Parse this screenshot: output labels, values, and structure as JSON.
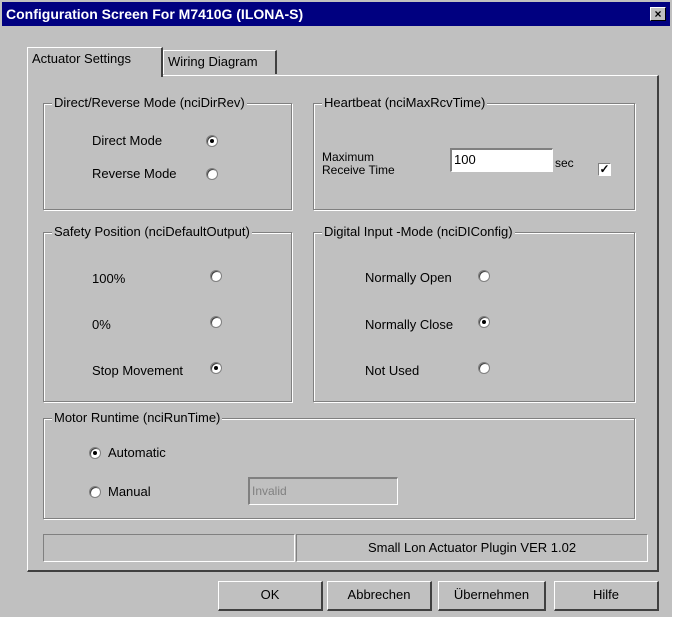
{
  "window": {
    "title": "Configuration Screen For M7410G (ILONA-S)",
    "close_label": "×"
  },
  "tabs": [
    {
      "label": "Actuator Settings",
      "active": true
    },
    {
      "label": "Wiring Diagram",
      "active": false
    }
  ],
  "direct_reverse": {
    "legend": "Direct/Reverse Mode (nciDirRev)",
    "options": [
      {
        "label": "Direct Mode",
        "selected": true
      },
      {
        "label": "Reverse Mode",
        "selected": false
      }
    ]
  },
  "heartbeat": {
    "legend": "Heartbeat (nciMaxRcvTime)",
    "label_line1": "Maximum",
    "label_line2": "Receive Time",
    "value": "100",
    "unit": "sec",
    "checked": true,
    "check_mark": "✓"
  },
  "safety_position": {
    "legend": "Safety Position (nciDefaultOutput)",
    "options": [
      {
        "label": "100%",
        "selected": false
      },
      {
        "label": "0%",
        "selected": false
      },
      {
        "label": "Stop Movement",
        "selected": true
      }
    ]
  },
  "digital_input": {
    "legend": "Digital Input -Mode (nciDIConfig)",
    "options": [
      {
        "label": "Normally Open",
        "selected": false
      },
      {
        "label": "Normally Close",
        "selected": true
      },
      {
        "label": "Not Used",
        "selected": false
      }
    ]
  },
  "motor_runtime": {
    "legend": "Motor Runtime (nciRunTime)",
    "options": [
      {
        "label": "Automatic",
        "selected": true
      },
      {
        "label": "Manual",
        "selected": false
      }
    ],
    "manual_value": "Invalid"
  },
  "status": {
    "left": "",
    "right": "Small Lon Actuator Plugin VER 1.02"
  },
  "buttons": {
    "ok": "OK",
    "cancel": "Abbrechen",
    "apply": "Übernehmen",
    "help": "Hilfe"
  }
}
